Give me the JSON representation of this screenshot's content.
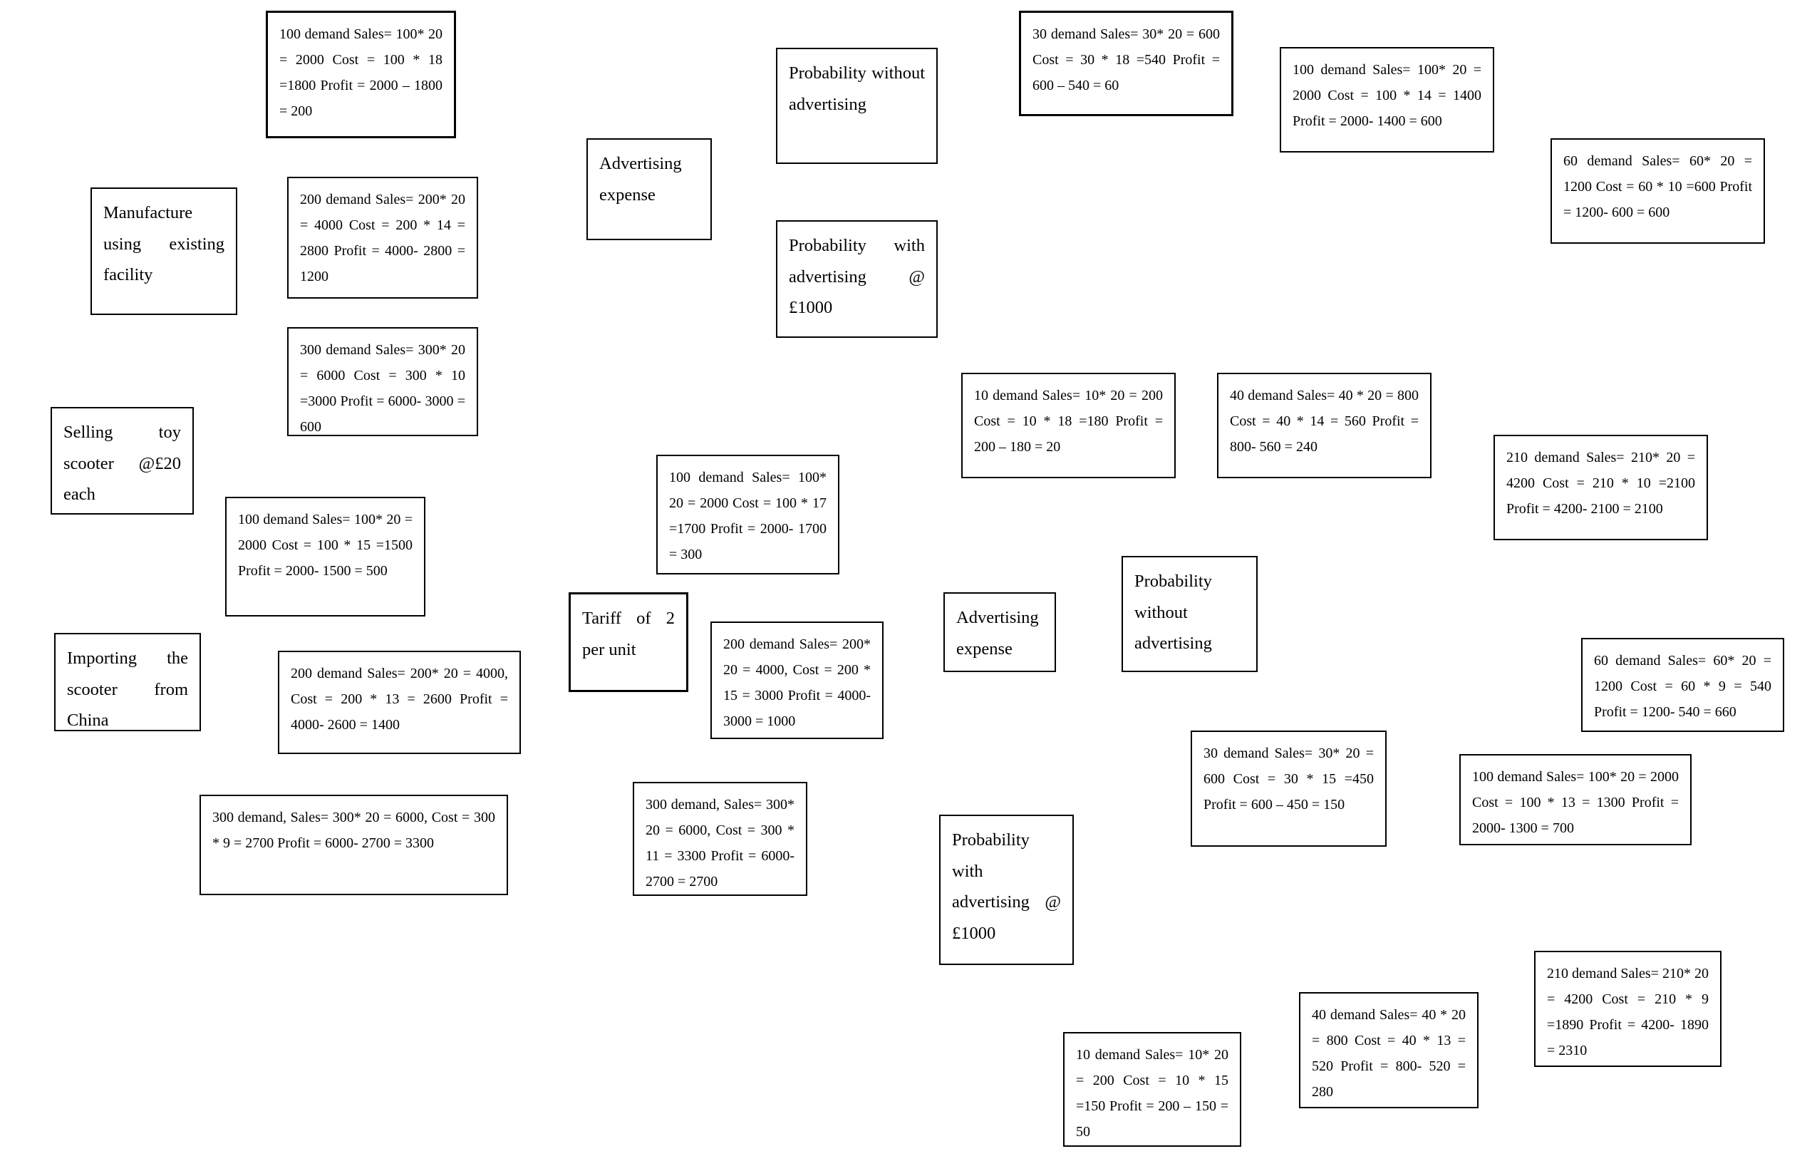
{
  "labels": {
    "manufacture": "Manufacture using existing facility",
    "selling": "Selling toy scooter @£20 each",
    "importing": "Importing the scooter from China",
    "advertising_expense_1": "Advertising expense",
    "prob_without_1": "Probability without advertising",
    "prob_with_1": "Probability with advertising @ £1000",
    "tariff": "Tariff of 2 per unit",
    "advertising_expense_2": "Advertising expense",
    "prob_without_2": "Probability without advertising",
    "prob_with_2": "Probability with advertising @ £1000"
  },
  "outcomes": {
    "manufacture": [
      "100 demand Sales= 100* 20 = 2000 Cost = 100 * 18 =1800 Profit = 2000 – 1800 = 200",
      "200 demand Sales= 200* 20 = 4000 Cost = 200 * 14 = 2800 Profit = 4000- 2800 = 1200",
      "300 demand Sales= 300* 20 = 6000 Cost = 300 * 10 =3000 Profit = 6000- 3000 = 600"
    ],
    "importing": [
      "100 demand Sales= 100* 20 = 2000 Cost = 100 * 15 =1500 Profit = 2000- 1500 = 500",
      "200 demand Sales= 200* 20 = 4000, Cost = 200 * 13 = 2600 Profit = 4000- 2600 = 1400",
      "300 demand, Sales= 300* 20 = 6000, Cost = 300 * 9 = 2700 Profit = 6000- 2700 = 3300"
    ],
    "tariff": [
      "100 demand Sales= 100* 20 = 2000 Cost = 100 * 17 =1700 Profit = 2000- 1700 = 300",
      "200 demand Sales= 200* 20 = 4000, Cost = 200 * 15 = 3000 Profit = 4000- 3000 = 1000",
      "300 demand, Sales= 300* 20 = 6000, Cost = 300 * 11 = 3300 Profit = 6000- 2700 = 2700"
    ],
    "advertising_1": [
      "30 demand Sales= 30* 20 = 600 Cost = 30 * 18 =540 Profit = 600 – 540 = 60",
      "100 demand Sales= 100* 20 = 2000 Cost = 100 * 14 = 1400 Profit = 2000- 1400 = 600",
      "60 demand Sales= 60* 20 = 1200 Cost = 60 * 10 =600 Profit = 1200- 600 = 600",
      "10 demand Sales= 10* 20 = 200 Cost = 10 * 18 =180 Profit = 200 – 180 = 20",
      "40 demand Sales= 40 * 20 = 800 Cost = 40 * 14 = 560 Profit = 800- 560 = 240",
      "210 demand Sales= 210* 20 = 4200 Cost = 210 * 10 =2100 Profit = 4200- 2100 = 2100"
    ],
    "advertising_2": [
      "60 demand Sales= 60* 20 = 1200 Cost = 60 * 9 = 540 Profit = 1200- 540 = 660",
      "30 demand Sales= 30* 20 = 600 Cost = 30 * 15 =450 Profit = 600 – 450 = 150",
      "100 demand Sales= 100* 20 = 2000 Cost = 100 * 13 = 1300 Profit = 2000- 1300 = 700",
      "10 demand Sales= 10* 20 = 200 Cost = 10 * 15 =150 Profit = 200 – 150 = 50",
      "40 demand Sales= 40 * 20 = 800 Cost = 40 * 13 = 520 Profit = 800- 520 = 280",
      "210 demand Sales= 210* 20 = 4200 Cost = 210 * 9 =1890 Profit = 4200- 1890 = 2310"
    ]
  }
}
